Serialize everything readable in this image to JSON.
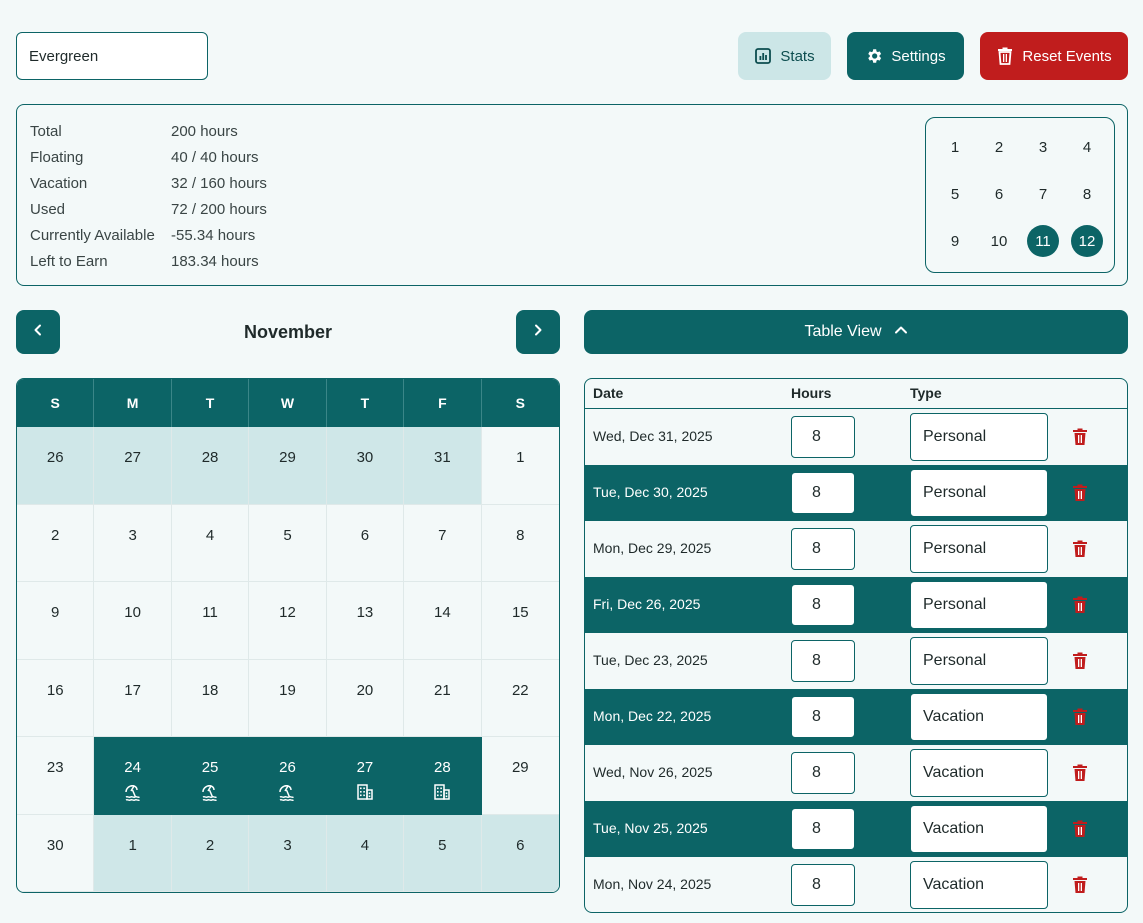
{
  "header": {
    "name_value": "Evergreen",
    "stats_label": "Stats",
    "settings_label": "Settings",
    "reset_label": "Reset Events"
  },
  "stats": [
    {
      "label": "Total",
      "value": "200 hours"
    },
    {
      "label": "Floating",
      "value": "40 / 40 hours"
    },
    {
      "label": "Vacation",
      "value": "32 / 160 hours"
    },
    {
      "label": "Used",
      "value": "72 / 200 hours"
    },
    {
      "label": "Currently Available",
      "value": "-55.34 hours"
    },
    {
      "label": "Left to Earn",
      "value": "183.34 hours"
    }
  ],
  "months": {
    "items": [
      "1",
      "2",
      "3",
      "4",
      "5",
      "6",
      "7",
      "8",
      "9",
      "10",
      "11",
      "12"
    ],
    "selected": [
      "11",
      "12"
    ]
  },
  "calendar": {
    "month_title": "November",
    "weekdays": [
      "S",
      "M",
      "T",
      "W",
      "T",
      "F",
      "S"
    ],
    "days": [
      {
        "n": "26",
        "s": "other"
      },
      {
        "n": "27",
        "s": "other"
      },
      {
        "n": "28",
        "s": "other"
      },
      {
        "n": "29",
        "s": "other"
      },
      {
        "n": "30",
        "s": "other"
      },
      {
        "n": "31",
        "s": "other"
      },
      {
        "n": "1",
        "s": ""
      },
      {
        "n": "2",
        "s": ""
      },
      {
        "n": "3",
        "s": ""
      },
      {
        "n": "4",
        "s": ""
      },
      {
        "n": "5",
        "s": ""
      },
      {
        "n": "6",
        "s": ""
      },
      {
        "n": "7",
        "s": ""
      },
      {
        "n": "8",
        "s": ""
      },
      {
        "n": "9",
        "s": ""
      },
      {
        "n": "10",
        "s": ""
      },
      {
        "n": "11",
        "s": ""
      },
      {
        "n": "12",
        "s": ""
      },
      {
        "n": "13",
        "s": ""
      },
      {
        "n": "14",
        "s": ""
      },
      {
        "n": "15",
        "s": ""
      },
      {
        "n": "16",
        "s": ""
      },
      {
        "n": "17",
        "s": ""
      },
      {
        "n": "18",
        "s": ""
      },
      {
        "n": "19",
        "s": ""
      },
      {
        "n": "20",
        "s": ""
      },
      {
        "n": "21",
        "s": ""
      },
      {
        "n": "22",
        "s": ""
      },
      {
        "n": "23",
        "s": ""
      },
      {
        "n": "24",
        "s": "event",
        "icon": "beach-icon"
      },
      {
        "n": "25",
        "s": "event",
        "icon": "beach-icon"
      },
      {
        "n": "26",
        "s": "event",
        "icon": "beach-icon"
      },
      {
        "n": "27",
        "s": "event",
        "icon": "building-icon"
      },
      {
        "n": "28",
        "s": "event",
        "icon": "building-icon"
      },
      {
        "n": "29",
        "s": ""
      },
      {
        "n": "30",
        "s": ""
      },
      {
        "n": "1",
        "s": "other"
      },
      {
        "n": "2",
        "s": "other"
      },
      {
        "n": "3",
        "s": "other"
      },
      {
        "n": "4",
        "s": "other"
      },
      {
        "n": "5",
        "s": "other"
      },
      {
        "n": "6",
        "s": "other"
      }
    ]
  },
  "table": {
    "toggle_label": "Table View",
    "columns": {
      "date": "Date",
      "hours": "Hours",
      "type": "Type"
    },
    "rows": [
      {
        "date": "Wed, Dec 31, 2025",
        "hours": "8",
        "type": "Personal"
      },
      {
        "date": "Tue, Dec 30, 2025",
        "hours": "8",
        "type": "Personal"
      },
      {
        "date": "Mon, Dec 29, 2025",
        "hours": "8",
        "type": "Personal"
      },
      {
        "date": "Fri, Dec 26, 2025",
        "hours": "8",
        "type": "Personal"
      },
      {
        "date": "Tue, Dec 23, 2025",
        "hours": "8",
        "type": "Personal"
      },
      {
        "date": "Mon, Dec 22, 2025",
        "hours": "8",
        "type": "Vacation"
      },
      {
        "date": "Wed, Nov 26, 2025",
        "hours": "8",
        "type": "Vacation"
      },
      {
        "date": "Tue, Nov 25, 2025",
        "hours": "8",
        "type": "Vacation"
      },
      {
        "date": "Mon, Nov 24, 2025",
        "hours": "8",
        "type": "Vacation"
      }
    ]
  },
  "colors": {
    "primary": "#0c6466",
    "danger": "#c01d1d",
    "light": "#cfe7e8",
    "background": "#f3f9f9"
  }
}
